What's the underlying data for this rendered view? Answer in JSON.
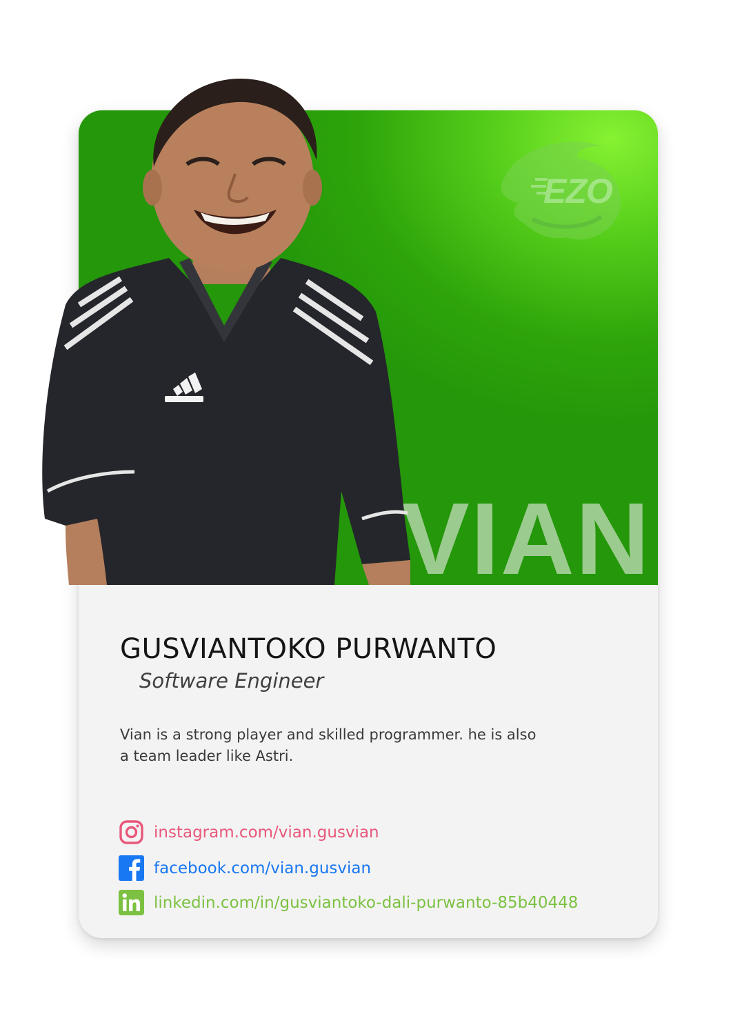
{
  "card": {
    "big_name": "VIAN",
    "logo_text": "EZO",
    "name": "GUSVIANTOKO PURWANTO",
    "role": "Software Engineer",
    "bio": "Vian is a strong player and skilled programmer. he is also a team leader like Astri."
  },
  "socials": [
    {
      "icon": "instagram-icon",
      "label": "instagram.com/vian.gusvian",
      "color": "#e8577a"
    },
    {
      "icon": "facebook-icon",
      "label": "facebook.com/vian.gusvian",
      "color": "#1877f2"
    },
    {
      "icon": "linkedin-icon",
      "label": "linkedin.com/in/gusviantoko-dali-purwanto-85b40448",
      "color": "#7cc142"
    }
  ],
  "colors": {
    "hero_green": "#2ea50a",
    "hero_light": "#86f232",
    "card_bg": "#f3f3f3"
  }
}
